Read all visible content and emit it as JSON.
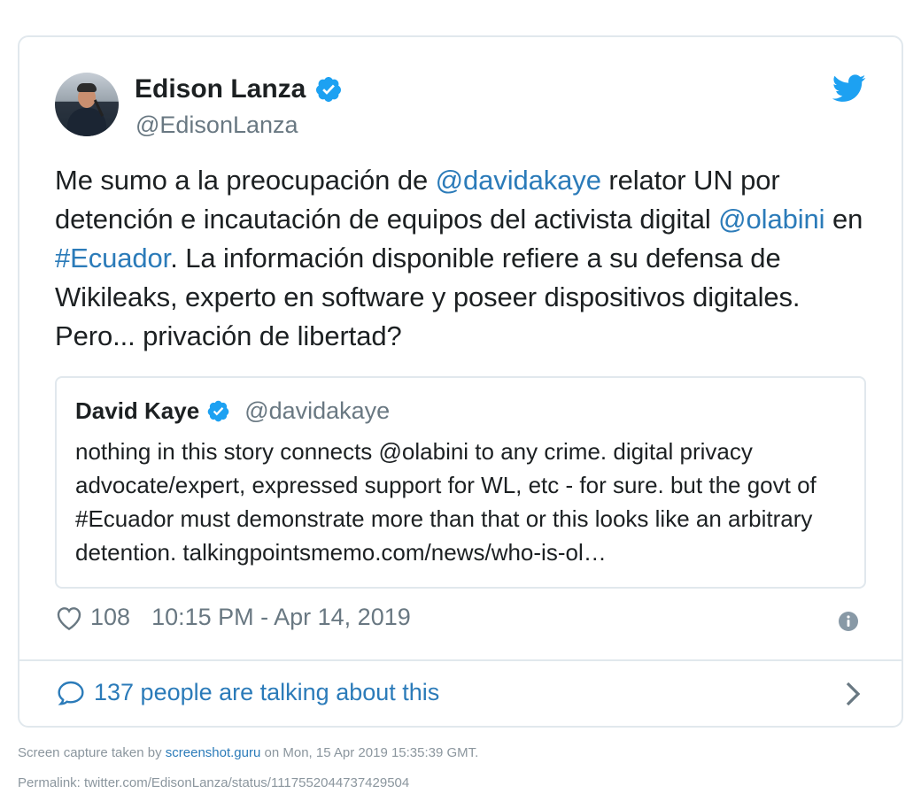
{
  "tweet": {
    "author": {
      "display_name": "Edison Lanza",
      "handle": "@EdisonLanza",
      "verified_icon": "verified-badge-icon"
    },
    "text_parts": [
      {
        "text": "Me sumo a la preocupación de ",
        "link": false
      },
      {
        "text": "@davidakaye",
        "link": true
      },
      {
        "text": " relator UN por detención e incautación de equipos del activista digital ",
        "link": false
      },
      {
        "text": "@olabini",
        "link": true
      },
      {
        "text": " en ",
        "link": false
      },
      {
        "text": "#Ecuador",
        "link": true
      },
      {
        "text": ". La información disponible refiere a su defensa de Wikileaks, experto en software y poseer dispositivos digitales. Pero... privación de libertad?",
        "link": false
      }
    ],
    "quoted": {
      "display_name": "David Kaye",
      "handle": "@davidakaye",
      "text": "nothing in this story connects @olabini to any crime. digital privacy advocate/expert, expressed support for WL, etc - for sure. but the govt of #Ecuador must demonstrate more than that or this looks like an arbitrary detention. talkingpointsmemo.com/news/who-is-ol…"
    },
    "likes": "108",
    "timestamp": "10:15 PM - Apr 14, 2019",
    "talking": "137 people are talking about this"
  },
  "footer": {
    "capture_prefix": "Screen capture taken by ",
    "capture_link": "screenshot.guru",
    "capture_suffix": " on Mon, 15 Apr 2019 15:35:39 GMT.",
    "permalink": "Permalink: twitter.com/EdisonLanza/status/1117552044737429504"
  },
  "colors": {
    "link": "#2b7bb9",
    "verified": "#1da1f2",
    "muted": "#697882",
    "border": "#e1e8ed"
  }
}
